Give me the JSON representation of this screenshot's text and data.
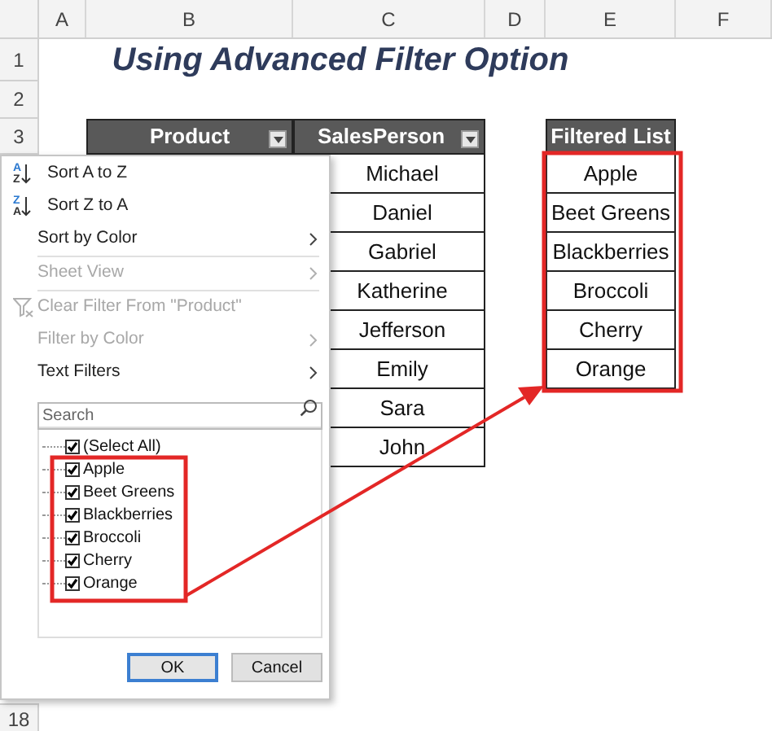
{
  "column_headers": [
    "A",
    "B",
    "C",
    "D",
    "E",
    "F"
  ],
  "row_numbers": [
    "1",
    "2",
    "3"
  ],
  "title": "Using Advanced Filter Option",
  "table": {
    "columns": [
      {
        "label": "Product"
      },
      {
        "label": "SalesPerson"
      }
    ],
    "salesperson": [
      "Michael",
      "Daniel",
      "Gabriel",
      "Katherine",
      "Jefferson",
      "Emily",
      "Sara",
      "John"
    ]
  },
  "filtered_list": {
    "header": "Filtered List",
    "items": [
      "Apple",
      "Beet Greens",
      "Blackberries",
      "Broccoli",
      "Cherry",
      "Orange"
    ]
  },
  "filter_menu": {
    "items": [
      {
        "kind": "sort",
        "label": "Sort A to Z",
        "letters": [
          "A",
          "Z"
        ],
        "disabled": false
      },
      {
        "kind": "sort",
        "label": "Sort Z to A",
        "letters": [
          "Z",
          "A"
        ],
        "disabled": false
      },
      {
        "kind": "submenu",
        "label": "Sort by Color",
        "disabled": false
      },
      {
        "kind": "separator"
      },
      {
        "kind": "submenu",
        "label": "Sheet View",
        "disabled": true
      },
      {
        "kind": "separator"
      },
      {
        "kind": "clear",
        "label": "Clear Filter From \"Product\"",
        "disabled": true
      },
      {
        "kind": "submenu",
        "label": "Filter by Color",
        "disabled": true
      },
      {
        "kind": "submenu",
        "label": "Text Filters",
        "disabled": false
      }
    ],
    "search": {
      "placeholder": "Search"
    },
    "values": [
      {
        "label": "(Select All)",
        "checked": true
      },
      {
        "label": "Apple",
        "checked": true
      },
      {
        "label": "Beet Greens",
        "checked": true
      },
      {
        "label": "Blackberries",
        "checked": true
      },
      {
        "label": "Broccoli",
        "checked": true
      },
      {
        "label": "Cherry",
        "checked": true
      },
      {
        "label": "Orange",
        "checked": true
      }
    ],
    "buttons": [
      {
        "label": "OK",
        "default": true
      },
      {
        "label": "Cancel",
        "default": false
      }
    ]
  },
  "bottom_row_number": "18"
}
